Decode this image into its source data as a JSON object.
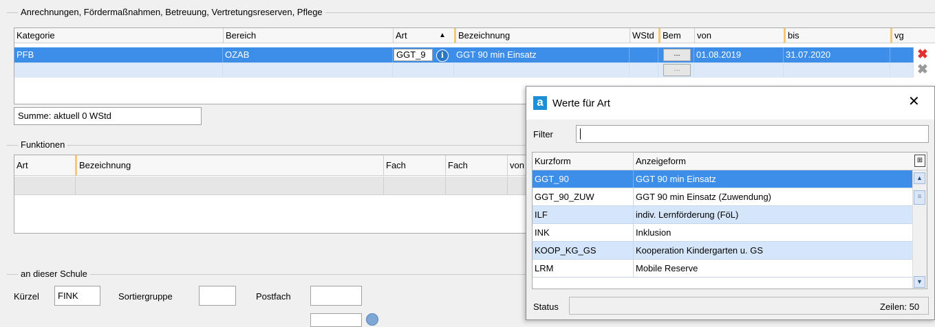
{
  "section_anrechnungen": {
    "title": "Anrechnungen, Fördermaßnahmen, Betreuung, Vertretungsreserven, Pflege",
    "columns": [
      "Kategorie",
      "Bereich",
      "Art",
      "Bezeichnung",
      "WStd",
      "Bem",
      "von",
      "bis",
      "vg"
    ],
    "sort_indicator": "▲",
    "selected_row": {
      "kategorie": "PFB",
      "bereich": "OZAB",
      "art": "GGT_9",
      "bezeichnung": "GGT 90 min Einsatz",
      "wstd": "",
      "bem_button": "...",
      "von": "01.08.2019",
      "bis": "31.07.2020"
    },
    "empty_row_bem_button": "...",
    "delete_icon": "red-x-delete-icon",
    "delete_disabled_icon": "gray-x-delete-icon",
    "info_icon": "info-icon",
    "summe": "Summe: aktuell 0 WStd"
  },
  "section_funktionen": {
    "title": "Funktionen",
    "columns": [
      "Art",
      "Bezeichnung",
      "Fach",
      "Fach",
      "von"
    ]
  },
  "section_schule": {
    "title": "an dieser Schule",
    "kuerzel_label": "Kürzel",
    "kuerzel_value": "FINK",
    "sortiergruppe_label": "Sortiergruppe",
    "sortiergruppe_value": "",
    "postfach_label": "Postfach",
    "postfach_value": ""
  },
  "dialog": {
    "title": "Werte für Art",
    "app_icon": "a",
    "close": "✕",
    "filter_label": "Filter",
    "filter_value": "",
    "columns": [
      "Kurzform",
      "Anzeigeform"
    ],
    "rows": [
      {
        "kurz": "GGT_90",
        "anzeige": "GGT 90 min Einsatz",
        "selected": true
      },
      {
        "kurz": "GGT_90_ZUW",
        "anzeige": "GGT 90 min Einsatz (Zuwendung)"
      },
      {
        "kurz": "ILF",
        "anzeige": "indiv. Lernförderung (FöL)"
      },
      {
        "kurz": "INK",
        "anzeige": "Inklusion"
      },
      {
        "kurz": "KOOP_KG_GS",
        "anzeige": "Kooperation Kindergarten u. GS"
      },
      {
        "kurz": "LRM",
        "anzeige": "Mobile Reserve"
      }
    ],
    "status_label": "Status",
    "status_value": "",
    "zeilen": "Zeilen: 50",
    "colors": {
      "selection": "#3d8ee9",
      "alt_row": "#d6e6fa",
      "brand": "#1e8fd6"
    }
  },
  "colors": {
    "header_separator": "#f5c979",
    "delete_red": "#e03030"
  }
}
